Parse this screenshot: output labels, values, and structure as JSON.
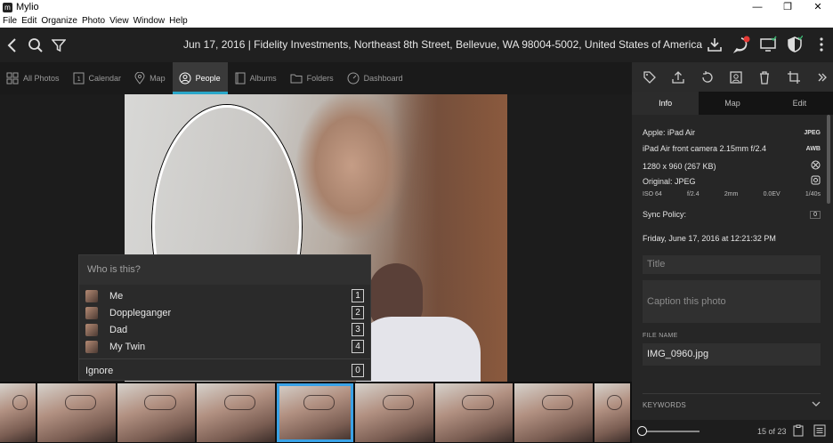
{
  "window": {
    "title": "Mylio",
    "app_icon": "m",
    "controls": [
      "minimize-icon",
      "restore-icon",
      "close-icon"
    ]
  },
  "menu": [
    "File",
    "Edit",
    "Organize",
    "Photo",
    "View",
    "Window",
    "Help"
  ],
  "toolbar": {
    "location": "Jun 17, 2016 | Fidelity Investments, Northeast 8th Street, Bellevue, WA 98004-5002, United States of America"
  },
  "nav_tabs": [
    {
      "label": "All Photos",
      "icon": "grid-icon"
    },
    {
      "label": "Calendar",
      "icon": "calendar-icon"
    },
    {
      "label": "Map",
      "icon": "map-pin-icon"
    },
    {
      "label": "People",
      "icon": "person-icon",
      "active": true
    },
    {
      "label": "Albums",
      "icon": "album-icon"
    },
    {
      "label": "Folders",
      "icon": "folder-icon"
    },
    {
      "label": "Dashboard",
      "icon": "dashboard-icon"
    }
  ],
  "who_panel": {
    "title": "Who is this?",
    "people": [
      {
        "name": "Me",
        "key": "1"
      },
      {
        "name": "Doppleganger",
        "key": "2"
      },
      {
        "name": "Dad",
        "key": "3"
      },
      {
        "name": "My Twin",
        "key": "4"
      }
    ],
    "ignore_label": "Ignore",
    "ignore_key": "0"
  },
  "right_tabs": [
    {
      "label": "Info",
      "active": true
    },
    {
      "label": "Map"
    },
    {
      "label": "Edit"
    }
  ],
  "info": {
    "camera": "Apple: iPad Air",
    "camera_tag": "JPEG",
    "lens": "iPad Air front camera 2.15mm f/2.4",
    "lens_tag": "AWB",
    "dimensions": "1280 x 960 (267 KB)",
    "original": "Original: JPEG",
    "exif": {
      "iso": "ISO 64",
      "aperture": "f/2.4",
      "focal": "2mm",
      "ev": "0.0EV",
      "shutter": "1/40s"
    },
    "sync_policy": "Sync Policy:",
    "sync_value": "0",
    "datetime": "Friday, June 17, 2016 at 12:21:32 PM",
    "title_placeholder": "Title",
    "caption_placeholder": "Caption this photo",
    "file_name_label": "FILE NAME",
    "file_name": "IMG_0960.jpg",
    "keywords_label": "KEYWORDS"
  },
  "footer": {
    "count": "15 of 23"
  },
  "colors": {
    "accent": "#2aa7c9",
    "selection": "#3aa2e6",
    "notification": "#e53935",
    "sync_ok": "#3cb371"
  }
}
